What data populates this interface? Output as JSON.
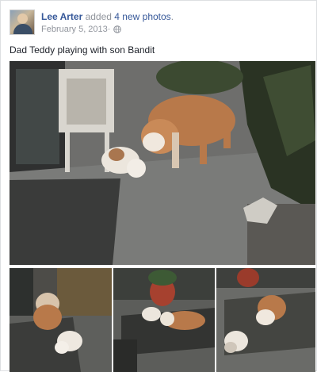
{
  "post": {
    "author": "Lee Arter",
    "action_text": " added ",
    "photos_link": "4 new photos",
    "period": ".",
    "date": "February 5, 2013",
    "dot": " · ",
    "privacy_icon": "globe-icon",
    "caption": "Dad Teddy playing with son Bandit"
  },
  "colors": {
    "link": "#365899",
    "meta": "#90949c",
    "text": "#1d2129"
  }
}
